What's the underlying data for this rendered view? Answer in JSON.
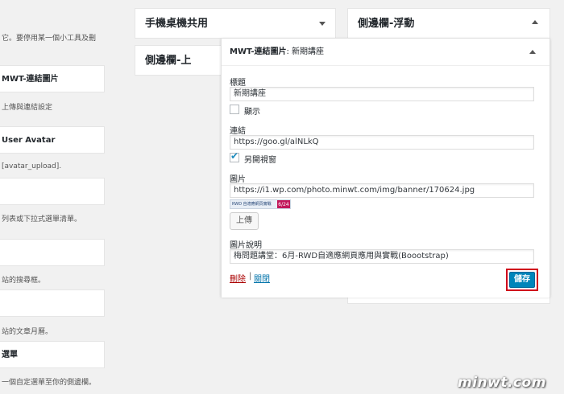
{
  "available_widgets": {
    "top_desc": "它。要停用某一個小工具及刪",
    "items": [
      {
        "title": "MWT-連結圖片",
        "desc": "上傳與連結設定"
      },
      {
        "title": "User Avatar",
        "desc": "[avatar_upload]."
      },
      {
        "title": "",
        "desc": "列表或下拉式選單清單。"
      },
      {
        "title": "",
        "desc": "站的搜尋框。"
      },
      {
        "title": "",
        "desc": "站的文章月曆。"
      },
      {
        "title": "選單",
        "desc": "一個自定選單至你的側邊欄。"
      }
    ]
  },
  "sidebars": {
    "mobile": {
      "title": "手機桌機共用"
    },
    "top": {
      "title": "側邊欄-上"
    },
    "float": {
      "title": "側邊欄-浮動"
    }
  },
  "widget": {
    "header_bold": "MWT-連結圖片",
    "header_rest": ": 新期講座",
    "title_label": "標題",
    "title_value": "新期講座",
    "show_label": "顯示",
    "show_checked": false,
    "link_label": "連結",
    "link_value": "https://goo.gl/alNLkQ",
    "new_window_label": "另開視窗",
    "new_window_checked": true,
    "image_label": "圖片",
    "image_value": "https://i1.wp.com/photo.minwt.com/img/banner/170624.jpg",
    "banner_text": "RWD 自適應網頁實戰",
    "banner_num": "6/24",
    "upload_label": "上傳",
    "desc_label": "圖片說明",
    "desc_value": "梅問題講堂：6月-RWD自適應網頁應用與實戰(Boootstrap)",
    "delete_label": "刪除",
    "separator": "|",
    "close_label": "關閉",
    "save_label": "儲存"
  },
  "watermark": "minwt.com",
  "colors": {
    "primary": "#0085ba",
    "highlight": "#d0021b",
    "delete": "#a00000",
    "link": "#0073aa"
  }
}
